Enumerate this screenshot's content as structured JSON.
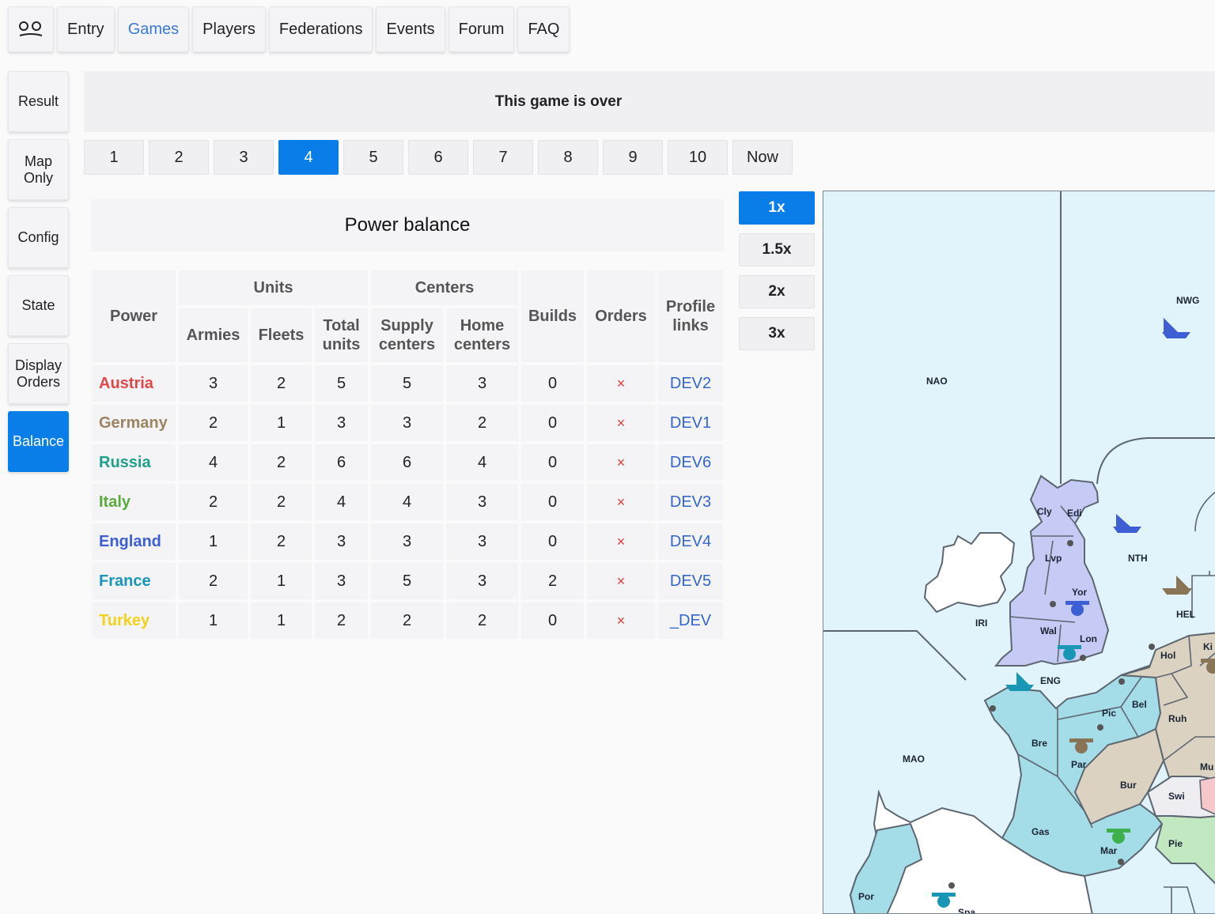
{
  "nav": {
    "logo_icon": "face-logo-icon",
    "items": [
      "Entry",
      "Games",
      "Players",
      "Federations",
      "Events",
      "Forum",
      "FAQ"
    ],
    "active": "Games"
  },
  "sidebar": {
    "items": [
      "Result",
      "Map Only",
      "Config",
      "State",
      "Display Orders",
      "Balance"
    ],
    "active": "Balance"
  },
  "banner": {
    "text": "This game is over"
  },
  "phases": {
    "items": [
      "1",
      "2",
      "3",
      "4",
      "5",
      "6",
      "7",
      "8",
      "9",
      "10",
      "Now"
    ],
    "active": "4"
  },
  "power_balance": {
    "title": "Power balance",
    "headers": {
      "power": "Power",
      "units": "Units",
      "centers": "Centers",
      "builds": "Builds",
      "orders": "Orders",
      "profile": "Profile links",
      "armies": "Armies",
      "fleets": "Fleets",
      "total_units": "Total units",
      "supply_centers": "Supply centers",
      "home_centers": "Home centers"
    },
    "rows": [
      {
        "power": "Austria",
        "color": "#e04848",
        "armies": "3",
        "fleets": "2",
        "total": "5",
        "supply": "5",
        "home": "3",
        "builds": "0",
        "orders": "×",
        "link": "DEV2"
      },
      {
        "power": "Germany",
        "color": "#9c8462",
        "armies": "2",
        "fleets": "1",
        "total": "3",
        "supply": "3",
        "home": "2",
        "builds": "0",
        "orders": "×",
        "link": "DEV1"
      },
      {
        "power": "Russia",
        "color": "#1fa08a",
        "armies": "4",
        "fleets": "2",
        "total": "6",
        "supply": "6",
        "home": "4",
        "builds": "0",
        "orders": "×",
        "link": "DEV6"
      },
      {
        "power": "Italy",
        "color": "#5aab3c",
        "armies": "2",
        "fleets": "2",
        "total": "4",
        "supply": "4",
        "home": "3",
        "builds": "0",
        "orders": "×",
        "link": "DEV3"
      },
      {
        "power": "England",
        "color": "#3e5fd4",
        "armies": "1",
        "fleets": "2",
        "total": "3",
        "supply": "3",
        "home": "3",
        "builds": "0",
        "orders": "×",
        "link": "DEV4"
      },
      {
        "power": "France",
        "color": "#1896b4",
        "armies": "2",
        "fleets": "1",
        "total": "3",
        "supply": "5",
        "home": "3",
        "builds": "2",
        "orders": "×",
        "link": "DEV5"
      },
      {
        "power": "Turkey",
        "color": "#f2d21a",
        "armies": "1",
        "fleets": "1",
        "total": "2",
        "supply": "2",
        "home": "2",
        "builds": "0",
        "orders": "×",
        "link": "_DEV"
      }
    ]
  },
  "zoom": {
    "items": [
      "1x",
      "1.5x",
      "2x",
      "3x"
    ],
    "active": "1x"
  },
  "map": {
    "labels": [
      "NWG",
      "NAO",
      "NTH",
      "Cly",
      "Edi",
      "Lvp",
      "Yor",
      "IRI",
      "Wal",
      "Lon",
      "HEL",
      "Hol",
      "Ki",
      "ENG",
      "Bel",
      "Pic",
      "Ruh",
      "Bre",
      "Par",
      "MAO",
      "Bur",
      "Mu",
      "Swi",
      "Gas",
      "Pie",
      "Mar",
      "Por",
      "Spa"
    ],
    "colors": {
      "sea": "#e2f4fb",
      "neutral": "#ffffff",
      "england": "#c5cbf5",
      "france": "#a4dde8",
      "germany": "#dcd2c1",
      "italy": "#c2e8c2",
      "austria": "#f6c8cc",
      "swiss": "#eeeef2"
    }
  }
}
